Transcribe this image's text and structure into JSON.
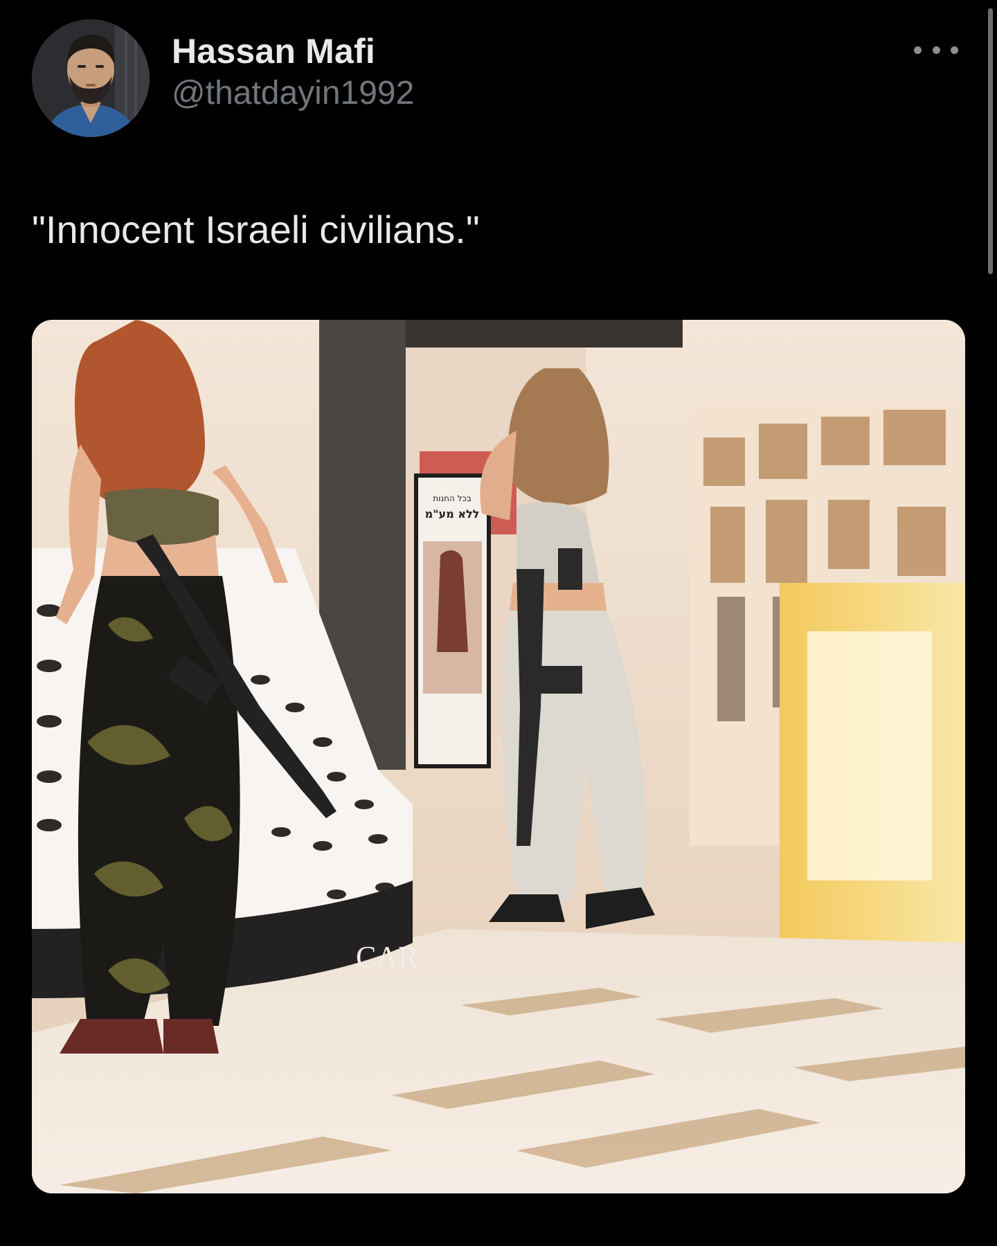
{
  "post": {
    "author": {
      "display_name": "Hassan Mafi",
      "handle": "@thatdayin1992",
      "avatar_icon": "profile-photo"
    },
    "text": "\"Innocent Israeli civilians.\"",
    "more_icon": "more-horizontal-icon"
  },
  "media": {
    "kind": "photo",
    "store_sign": "CAR",
    "poster_lines": [
      "בכל החנות",
      "ללא מע\"מ"
    ]
  },
  "colors": {
    "background": "#000000",
    "text_primary": "#e7e9ea",
    "text_secondary": "#71767b"
  }
}
